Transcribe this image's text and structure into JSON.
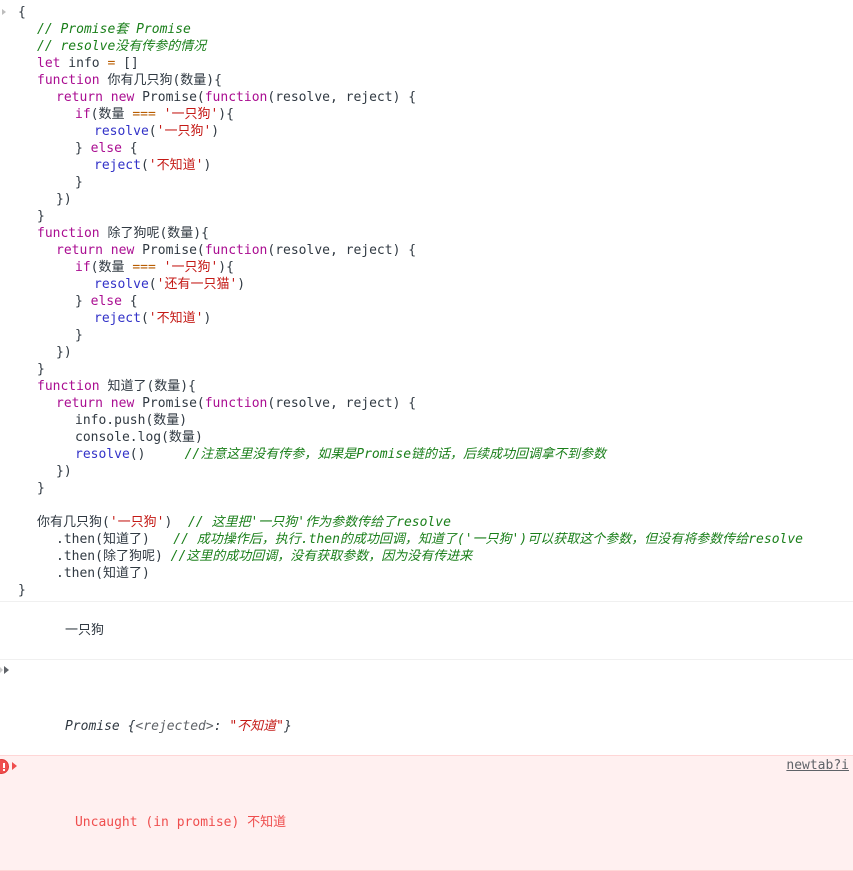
{
  "console": {
    "echoed_source": {
      "lines": [
        {
          "indent": 0,
          "tokens": [
            {
              "t": "punc",
              "v": "{"
            }
          ]
        },
        {
          "indent": 1,
          "tokens": [
            {
              "t": "cmt",
              "v": "// Promise套 Promise"
            }
          ]
        },
        {
          "indent": 1,
          "tokens": [
            {
              "t": "cmt",
              "v": "// resolve没有传参的情况"
            }
          ]
        },
        {
          "indent": 1,
          "tokens": [
            {
              "t": "kw",
              "v": "let"
            },
            {
              "t": "ident",
              "v": " info "
            },
            {
              "t": "op",
              "v": "="
            },
            {
              "t": "punc",
              "v": " []"
            }
          ]
        },
        {
          "indent": 1,
          "tokens": [
            {
              "t": "kw",
              "v": "function"
            },
            {
              "t": "fn",
              "v": " 你有几只狗"
            },
            {
              "t": "punc",
              "v": "("
            },
            {
              "t": "ident",
              "v": "数量"
            },
            {
              "t": "punc",
              "v": "){"
            }
          ]
        },
        {
          "indent": 2,
          "tokens": [
            {
              "t": "ret",
              "v": "return"
            },
            {
              "t": "kw",
              "v": " new"
            },
            {
              "t": "ident",
              "v": " Promise"
            },
            {
              "t": "punc",
              "v": "("
            },
            {
              "t": "kw",
              "v": "function"
            },
            {
              "t": "punc",
              "v": "("
            },
            {
              "t": "ident",
              "v": "resolve, reject"
            },
            {
              "t": "punc",
              "v": ") {"
            }
          ]
        },
        {
          "indent": 3,
          "tokens": [
            {
              "t": "kw2",
              "v": "if"
            },
            {
              "t": "punc",
              "v": "("
            },
            {
              "t": "ident",
              "v": "数量 "
            },
            {
              "t": "op",
              "v": "==="
            },
            {
              "t": "str",
              "v": " '一只狗'"
            },
            {
              "t": "punc",
              "v": "){"
            }
          ]
        },
        {
          "indent": 4,
          "tokens": [
            {
              "t": "blue",
              "v": "resolve"
            },
            {
              "t": "punc",
              "v": "("
            },
            {
              "t": "str",
              "v": "'一只狗'"
            },
            {
              "t": "punc",
              "v": ")"
            }
          ]
        },
        {
          "indent": 3,
          "tokens": [
            {
              "t": "punc",
              "v": "} "
            },
            {
              "t": "kw",
              "v": "else"
            },
            {
              "t": "punc",
              "v": " {"
            }
          ]
        },
        {
          "indent": 4,
          "tokens": [
            {
              "t": "blue",
              "v": "reject"
            },
            {
              "t": "punc",
              "v": "("
            },
            {
              "t": "str",
              "v": "'不知道'"
            },
            {
              "t": "punc",
              "v": ")"
            }
          ]
        },
        {
          "indent": 3,
          "tokens": [
            {
              "t": "punc",
              "v": "}"
            }
          ]
        },
        {
          "indent": 2,
          "tokens": [
            {
              "t": "punc",
              "v": "})"
            }
          ]
        },
        {
          "indent": 1,
          "tokens": [
            {
              "t": "punc",
              "v": "}"
            }
          ]
        },
        {
          "indent": 1,
          "tokens": [
            {
              "t": "kw",
              "v": "function"
            },
            {
              "t": "fn",
              "v": " 除了狗呢"
            },
            {
              "t": "punc",
              "v": "("
            },
            {
              "t": "ident",
              "v": "数量"
            },
            {
              "t": "punc",
              "v": "){"
            }
          ]
        },
        {
          "indent": 2,
          "tokens": [
            {
              "t": "ret",
              "v": "return"
            },
            {
              "t": "kw",
              "v": " new"
            },
            {
              "t": "ident",
              "v": " Promise"
            },
            {
              "t": "punc",
              "v": "("
            },
            {
              "t": "kw",
              "v": "function"
            },
            {
              "t": "punc",
              "v": "("
            },
            {
              "t": "ident",
              "v": "resolve, reject"
            },
            {
              "t": "punc",
              "v": ") {"
            }
          ]
        },
        {
          "indent": 3,
          "tokens": [
            {
              "t": "kw2",
              "v": "if"
            },
            {
              "t": "punc",
              "v": "("
            },
            {
              "t": "ident",
              "v": "数量 "
            },
            {
              "t": "op",
              "v": "==="
            },
            {
              "t": "str",
              "v": " '一只狗'"
            },
            {
              "t": "punc",
              "v": "){"
            }
          ]
        },
        {
          "indent": 4,
          "tokens": [
            {
              "t": "blue",
              "v": "resolve"
            },
            {
              "t": "punc",
              "v": "("
            },
            {
              "t": "str",
              "v": "'还有一只猫'"
            },
            {
              "t": "punc",
              "v": ")"
            }
          ]
        },
        {
          "indent": 3,
          "tokens": [
            {
              "t": "punc",
              "v": "} "
            },
            {
              "t": "kw",
              "v": "else"
            },
            {
              "t": "punc",
              "v": " {"
            }
          ]
        },
        {
          "indent": 4,
          "tokens": [
            {
              "t": "blue",
              "v": "reject"
            },
            {
              "t": "punc",
              "v": "("
            },
            {
              "t": "str",
              "v": "'不知道'"
            },
            {
              "t": "punc",
              "v": ")"
            }
          ]
        },
        {
          "indent": 3,
          "tokens": [
            {
              "t": "punc",
              "v": "}"
            }
          ]
        },
        {
          "indent": 2,
          "tokens": [
            {
              "t": "punc",
              "v": "})"
            }
          ]
        },
        {
          "indent": 1,
          "tokens": [
            {
              "t": "punc",
              "v": "}"
            }
          ]
        },
        {
          "indent": 1,
          "tokens": [
            {
              "t": "kw",
              "v": "function"
            },
            {
              "t": "fn",
              "v": " 知道了"
            },
            {
              "t": "punc",
              "v": "("
            },
            {
              "t": "ident",
              "v": "数量"
            },
            {
              "t": "punc",
              "v": "){"
            }
          ]
        },
        {
          "indent": 2,
          "tokens": [
            {
              "t": "ret",
              "v": "return"
            },
            {
              "t": "kw",
              "v": " new"
            },
            {
              "t": "ident",
              "v": " Promise"
            },
            {
              "t": "punc",
              "v": "("
            },
            {
              "t": "kw",
              "v": "function"
            },
            {
              "t": "punc",
              "v": "("
            },
            {
              "t": "ident",
              "v": "resolve, reject"
            },
            {
              "t": "punc",
              "v": ") {"
            }
          ]
        },
        {
          "indent": 3,
          "tokens": [
            {
              "t": "ident",
              "v": "info.push"
            },
            {
              "t": "punc",
              "v": "("
            },
            {
              "t": "ident",
              "v": "数量"
            },
            {
              "t": "punc",
              "v": ")"
            }
          ]
        },
        {
          "indent": 3,
          "tokens": [
            {
              "t": "ident",
              "v": "console.log"
            },
            {
              "t": "punc",
              "v": "("
            },
            {
              "t": "ident",
              "v": "数量"
            },
            {
              "t": "punc",
              "v": ")"
            }
          ]
        },
        {
          "indent": 3,
          "tokens": [
            {
              "t": "blue",
              "v": "resolve"
            },
            {
              "t": "punc",
              "v": "()"
            },
            {
              "t": "cmt",
              "v": "     //注意这里没有传参，如果是Promise链的话，后续成功回调拿不到参数"
            }
          ]
        },
        {
          "indent": 2,
          "tokens": [
            {
              "t": "punc",
              "v": "})"
            }
          ]
        },
        {
          "indent": 1,
          "tokens": [
            {
              "t": "punc",
              "v": "}"
            }
          ]
        },
        {
          "indent": 0,
          "tokens": [
            {
              "t": "punc",
              "v": ""
            }
          ]
        },
        {
          "indent": 1,
          "tokens": [
            {
              "t": "ident",
              "v": "你有几只狗"
            },
            {
              "t": "punc",
              "v": "("
            },
            {
              "t": "str",
              "v": "'一只狗'"
            },
            {
              "t": "punc",
              "v": ")"
            },
            {
              "t": "cmt",
              "v": "  // 这里把'一只狗'作为参数传给了resolve"
            }
          ]
        },
        {
          "indent": 2,
          "tokens": [
            {
              "t": "punc",
              "v": ".then("
            },
            {
              "t": "ident",
              "v": "知道了"
            },
            {
              "t": "punc",
              "v": ")"
            },
            {
              "t": "cmt",
              "v": "   // 成功操作后，执行.then的成功回调，知道了('一只狗')可以获取这个参数，但没有将参数传给resolve"
            }
          ]
        },
        {
          "indent": 2,
          "tokens": [
            {
              "t": "punc",
              "v": ".then("
            },
            {
              "t": "ident",
              "v": "除了狗呢"
            },
            {
              "t": "punc",
              "v": ")"
            },
            {
              "t": "cmt",
              "v": " //这里的成功回调，没有获取参数，因为没有传进来"
            }
          ]
        },
        {
          "indent": 2,
          "tokens": [
            {
              "t": "punc",
              "v": ".then("
            },
            {
              "t": "ident",
              "v": "知道了"
            },
            {
              "t": "punc",
              "v": ")"
            }
          ]
        },
        {
          "indent": 0,
          "tokens": [
            {
              "t": "punc",
              "v": "}"
            }
          ]
        }
      ]
    },
    "messages": [
      {
        "kind": "log",
        "text": "一只狗"
      },
      {
        "kind": "object",
        "name": "Promise",
        "open_brace": " {",
        "state": "<rejected>",
        "colon": ": ",
        "value": "\"不知道\"",
        "close_brace": "}"
      },
      {
        "kind": "error",
        "text": "Uncaught (in promise) ",
        "reason": "不知道",
        "source_link": "newtab?i"
      }
    ]
  },
  "colors": {
    "keyword": "#aa0d91",
    "string": "#c41a16",
    "comment": "#1a7f1a",
    "identifier": "#303942",
    "callable": "#3232c8",
    "operator": "#b85c00",
    "error_text": "#ef4e4e",
    "error_background": "#fff0f0"
  }
}
